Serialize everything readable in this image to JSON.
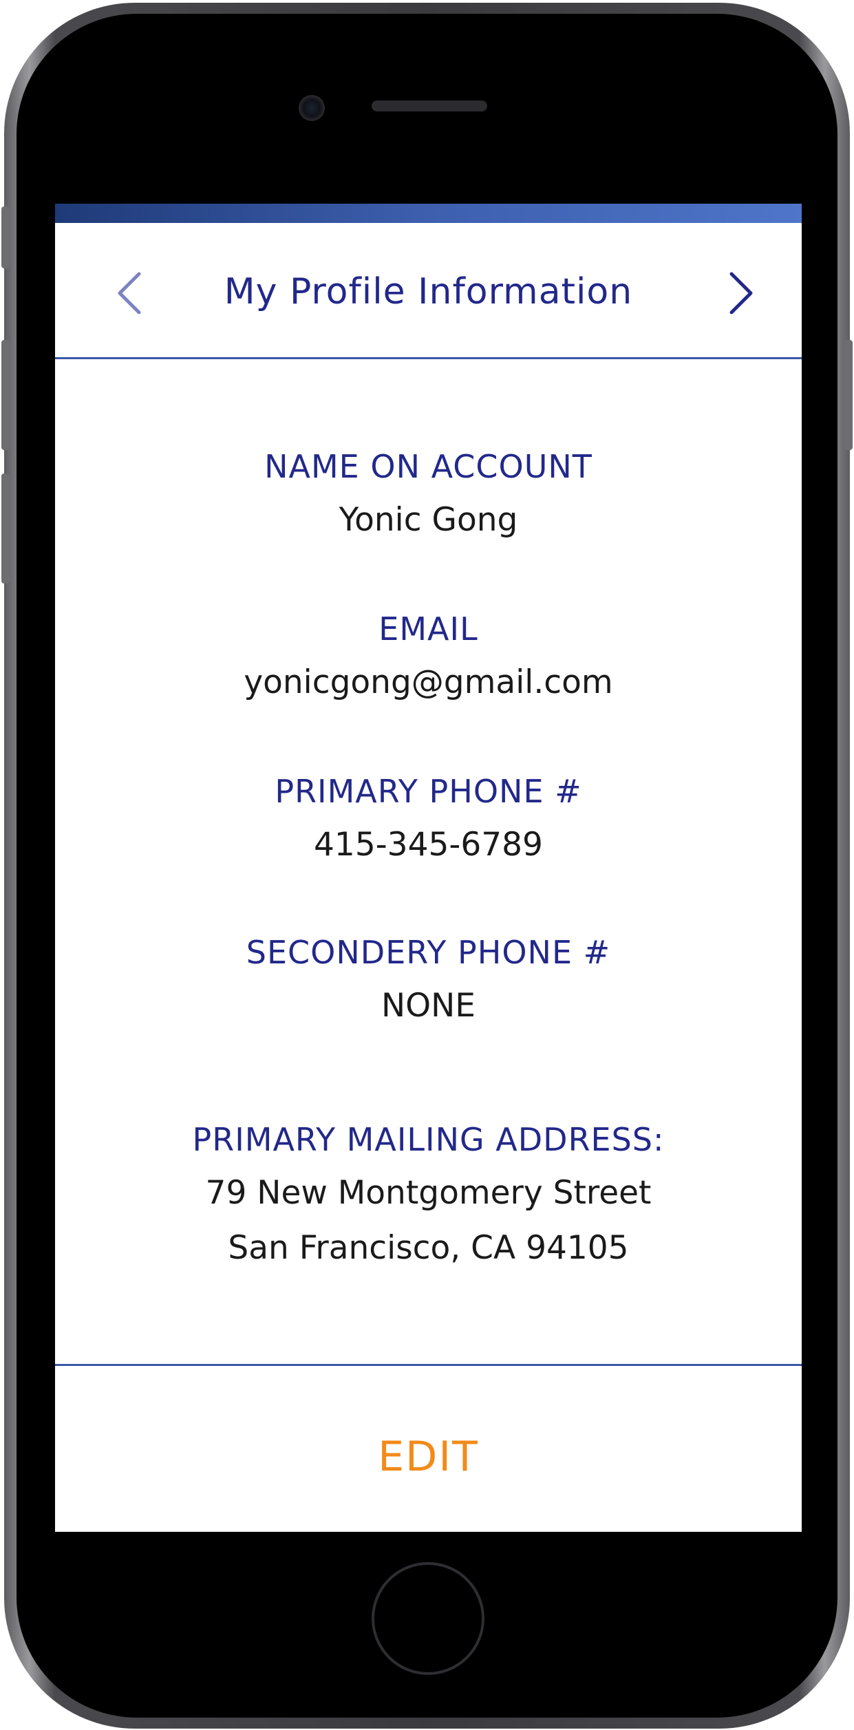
{
  "header": {
    "title": "My Profile Information",
    "prev_icon": "chevron-left-icon",
    "next_icon": "chevron-right-icon"
  },
  "profile": {
    "name_label": "NAME ON ACCOUNT",
    "name_value": "Yonic Gong",
    "email_label": "EMAIL",
    "email_value": "yonicgong@gmail.com",
    "primary_phone_label": "PRIMARY PHONE #",
    "primary_phone_value": "415-345-6789",
    "secondary_phone_label": "SECONDERY PHONE #",
    "secondary_phone_value": "NONE",
    "address_label": "PRIMARY MAILING ADDRESS:",
    "address_line1": "79 New Montgomery Street",
    "address_line2": "San Francisco, CA 94105"
  },
  "actions": {
    "edit_label": "EDIT"
  },
  "colors": {
    "accent_navy": "#22288a",
    "divider_blue": "#3b57a8",
    "edit_orange": "#f28a1a",
    "prev_arrow": "#7b83c4"
  }
}
